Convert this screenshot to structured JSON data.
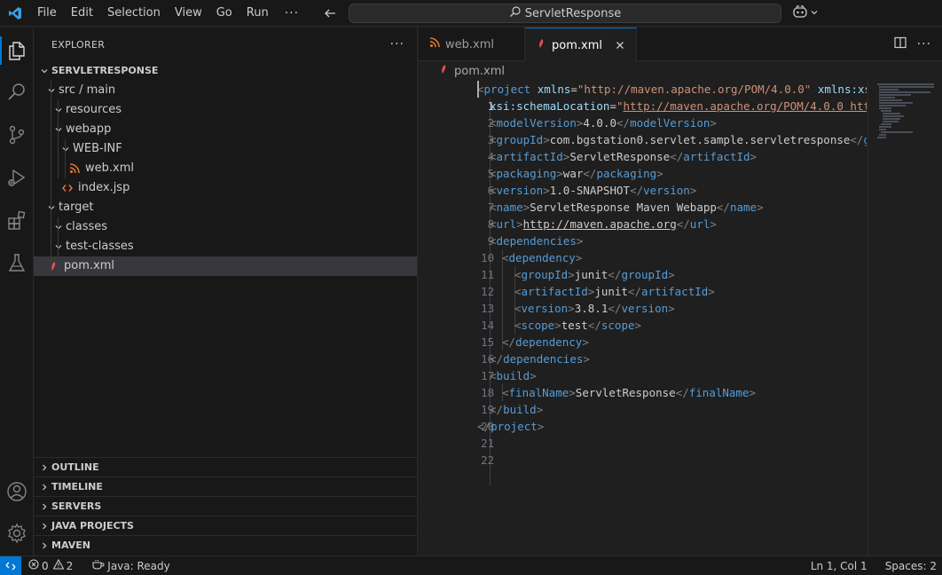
{
  "titlebar": {
    "menus": [
      "File",
      "Edit",
      "Selection",
      "View",
      "Go",
      "Run"
    ],
    "more": "···",
    "search_text": "ServletResponse"
  },
  "sidebar": {
    "title": "EXPLORER",
    "more": "···",
    "tree": [
      {
        "label": "SERVLETRESPONSE"
      },
      {
        "label": "src / main"
      },
      {
        "label": "resources"
      },
      {
        "label": "webapp"
      },
      {
        "label": "WEB-INF"
      },
      {
        "label": "web.xml"
      },
      {
        "label": "index.jsp"
      },
      {
        "label": "target"
      },
      {
        "label": "classes"
      },
      {
        "label": "test-classes"
      },
      {
        "label": "pom.xml"
      }
    ],
    "panels": [
      "OUTLINE",
      "TIMELINE",
      "SERVERS",
      "JAVA PROJECTS",
      "MAVEN"
    ]
  },
  "editor": {
    "tabs": [
      "web.xml",
      "pom.xml"
    ],
    "breadcrumb": "pom.xml",
    "line_numbers": [
      "1",
      "2",
      "3",
      "4",
      "5",
      "6",
      "7",
      "8",
      "9",
      "10",
      "11",
      "12",
      "13",
      "14",
      "15",
      "16",
      "17",
      "18",
      "19",
      "20",
      "21",
      "22"
    ],
    "code": {
      "l1": [
        "<",
        "project",
        " xmlns",
        "=",
        "\"http://maven.apache.org/POM/4.0.0\"",
        " xmlns:xsi",
        "=",
        "\"h"
      ],
      "l2": [
        "xsi:schemaLocation",
        "=",
        "\"http://maven.apache.org/POM/4.0.0",
        " http://"
      ],
      "l3": [
        "<",
        "modelVersion",
        ">",
        "4.0.0",
        "</",
        "modelVersion",
        ">"
      ],
      "l4": [
        "<",
        "groupId",
        ">",
        "com.bgstation0.servlet.sample.servletresponse",
        "</",
        "group"
      ],
      "l5": [
        "<",
        "artifactId",
        ">",
        "ServletResponse",
        "</",
        "artifactId",
        ">"
      ],
      "l6": [
        "<",
        "packaging",
        ">",
        "war",
        "</",
        "packaging",
        ">"
      ],
      "l7": [
        "<",
        "version",
        ">",
        "1.0-SNAPSHOT",
        "</",
        "version",
        ">"
      ],
      "l8": [
        "<",
        "name",
        ">",
        "ServletResponse Maven Webapp",
        "</",
        "name",
        ">"
      ],
      "l9": [
        "<",
        "url",
        ">",
        "http://maven.apache.org",
        "</",
        "url",
        ">"
      ],
      "l10": [
        "<",
        "dependencies",
        ">"
      ],
      "l11": [
        "<",
        "dependency",
        ">"
      ],
      "l12": [
        "<",
        "groupId",
        ">",
        "junit",
        "</",
        "groupId",
        ">"
      ],
      "l13": [
        "<",
        "artifactId",
        ">",
        "junit",
        "</",
        "artifactId",
        ">"
      ],
      "l14": [
        "<",
        "version",
        ">",
        "3.8.1",
        "</",
        "version",
        ">"
      ],
      "l15": [
        "<",
        "scope",
        ">",
        "test",
        "</",
        "scope",
        ">"
      ],
      "l16": [
        "</",
        "dependency",
        ">"
      ],
      "l17": [
        "</",
        "dependencies",
        ">"
      ],
      "l18": [
        "<",
        "build",
        ">"
      ],
      "l19": [
        "<",
        "finalName",
        ">",
        "ServletResponse",
        "</",
        "finalName",
        ">"
      ],
      "l20": [
        "</",
        "build",
        ">"
      ],
      "l21": [
        "</",
        "project",
        ">"
      ]
    }
  },
  "statusbar": {
    "errors": "0",
    "warnings": "2",
    "java_status": "Java: Ready",
    "cursor_position": "Ln 1, Col 1",
    "indentation": "Spaces: 2"
  },
  "colors": {
    "accent": "#0078d4",
    "xml_icon": "#e37933",
    "maven_icon": "#e05252",
    "jsp_icon": "#e37933"
  }
}
